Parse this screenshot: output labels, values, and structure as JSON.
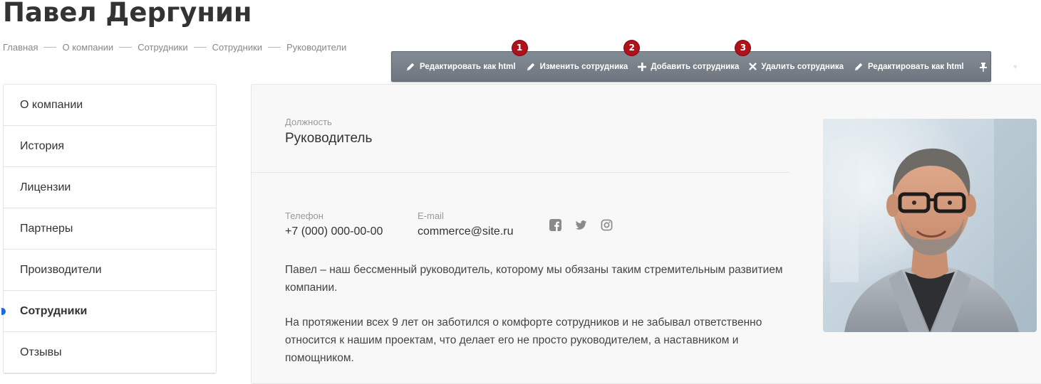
{
  "page": {
    "title": "Павел Дергунин"
  },
  "breadcrumb": [
    {
      "label": "Главная"
    },
    {
      "label": "О компании"
    },
    {
      "label": "Сотрудники"
    },
    {
      "label": "Сотрудники"
    },
    {
      "label": "Руководители"
    }
  ],
  "admin_toolbar": {
    "buttons": [
      {
        "label": "Редактировать как html",
        "icon": "pencil-icon"
      },
      {
        "label": "Изменить сотрудника",
        "icon": "pencil-icon",
        "badge": "1"
      },
      {
        "label": "Добавить сотрудника",
        "icon": "plus-icon",
        "badge": "2"
      },
      {
        "label": "Удалить сотрудника",
        "icon": "close-icon",
        "badge": "3"
      },
      {
        "label": "Редактировать как html",
        "icon": "pencil-icon"
      }
    ],
    "badge_color": "#b0111a",
    "bar_color": "#767d86"
  },
  "sidebar": {
    "items": [
      {
        "label": "О компании",
        "active": false
      },
      {
        "label": "История",
        "active": false
      },
      {
        "label": "Лицензии",
        "active": false
      },
      {
        "label": "Партнеры",
        "active": false
      },
      {
        "label": "Производители",
        "active": false
      },
      {
        "label": "Сотрудники",
        "active": true
      },
      {
        "label": "Отзывы",
        "active": false
      }
    ],
    "accent_color": "#1c6bd8"
  },
  "employee": {
    "position_label": "Должность",
    "position": "Руководитель",
    "phone_label": "Телефон",
    "phone": "+7 (000) 000-00-00",
    "email_label": "E-mail",
    "email": "commerce@site.ru",
    "socials": [
      "facebook-icon",
      "twitter-icon",
      "instagram-icon"
    ],
    "bio": [
      "Павел – наш бессменный руководитель, которому мы обязаны таким стремительным развитием компании.",
      "На протяжении всех 9 лет он заботился о комфорте сотрудников и не забывал ответственно относится к нашим проектам, что делает его не просто руководителем, а наставником и помощником."
    ]
  }
}
